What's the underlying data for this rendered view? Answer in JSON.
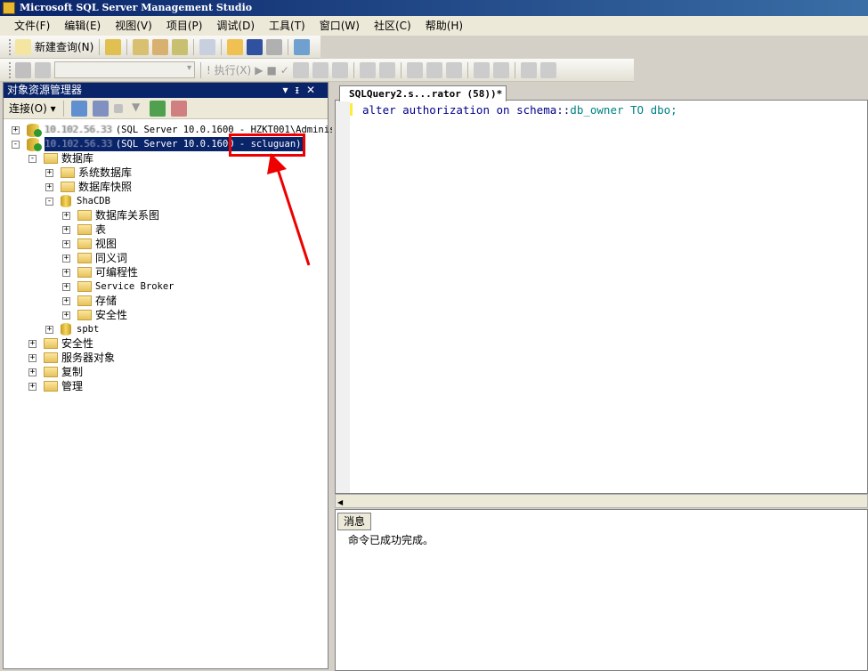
{
  "window": {
    "title": "Microsoft SQL Server Management Studio"
  },
  "menu": [
    "文件(F)",
    "编辑(E)",
    "视图(V)",
    "项目(P)",
    "调试(D)",
    "工具(T)",
    "窗口(W)",
    "社区(C)",
    "帮助(H)"
  ],
  "toolbar": {
    "new_query": "新建查询(N)",
    "execute": "! 执行(X)"
  },
  "object_explorer": {
    "title": "对象资源管理器",
    "connect": "连接(O) ▾",
    "nodes": [
      {
        "label": "(SQL Server 10.0.1600 - HZKT001\\Administ",
        "redacted": "10.102.56.33"
      },
      {
        "label": "(SQL Server 10.0.1600 - scluguan)",
        "redacted": "10.102.56.33"
      },
      {
        "label": "数据库"
      },
      {
        "label": "系统数据库"
      },
      {
        "label": "数据库快照"
      },
      {
        "label": "ShaCDB"
      },
      {
        "label": "数据库关系图"
      },
      {
        "label": "表"
      },
      {
        "label": "视图"
      },
      {
        "label": "同义词"
      },
      {
        "label": "可编程性"
      },
      {
        "label": "Service Broker"
      },
      {
        "label": "存储"
      },
      {
        "label": "安全性"
      },
      {
        "label": "spbt"
      },
      {
        "label": "安全性"
      },
      {
        "label": "服务器对象"
      },
      {
        "label": "复制"
      },
      {
        "label": "管理"
      }
    ]
  },
  "editor": {
    "tab": "SQLQuery2.s...rator (58))*",
    "code_kw": "alter authorization on schema::",
    "code_rest": "db_owner TO dbo;"
  },
  "results": {
    "tab": "消息",
    "message": "命令已成功完成。"
  }
}
